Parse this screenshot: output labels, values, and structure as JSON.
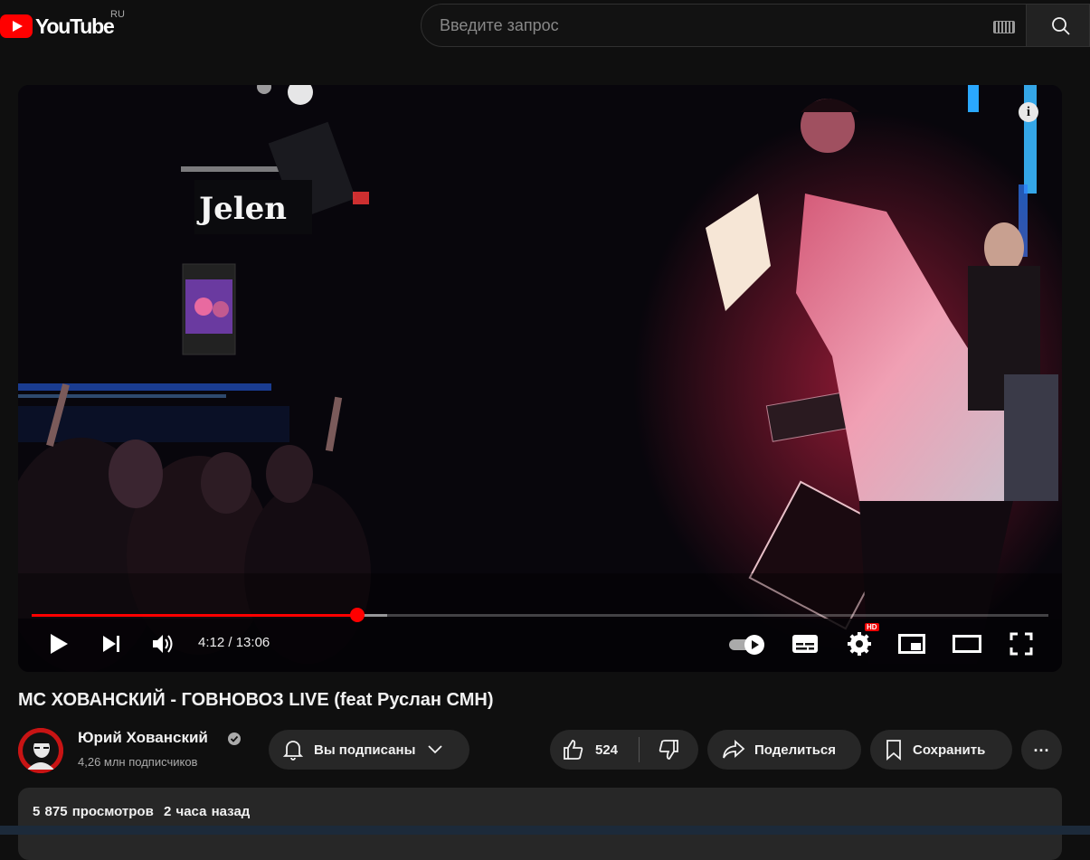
{
  "masthead": {
    "logo_text": "YouTube",
    "country_code": "RU",
    "search_placeholder": "Введите запрос",
    "keyboard_icon": "keyboard-icon",
    "search_icon": "search-icon"
  },
  "player": {
    "time_current": "4:12",
    "time_separator": " / ",
    "time_total": "13:06",
    "progress": {
      "played_fraction": 0.32,
      "buffered_fraction": 0.35
    },
    "venue_sign": "Jelen",
    "controls": {
      "play_icon": "play-icon",
      "next_icon": "next-icon",
      "volume_icon": "volume-icon",
      "autoplay_icon": "autoplay-toggle-icon",
      "subtitles_icon": "subtitles-icon",
      "settings_icon": "settings-icon",
      "settings_badge": "HD",
      "miniplayer_icon": "miniplayer-icon",
      "theater_icon": "theater-mode-icon",
      "fullscreen_icon": "fullscreen-icon"
    },
    "info_icon": "i"
  },
  "video": {
    "title": "MC ХОВАНСКИЙ - ГОВНОВОЗ LIVE (feat Руслан СМН)",
    "channel_name": "Юрий Хованский",
    "subscribers": "4,26 млн подписчиков",
    "subscribe_label": "Вы подписаны",
    "likes": "524",
    "share_label": "Поделиться",
    "save_label": "Сохранить",
    "more_label": "..."
  },
  "description": {
    "views": "5 875 просмотров",
    "date": "2 часа назад"
  },
  "colors": {
    "background": "#0f0f0f",
    "accent_red": "#ff0000",
    "pill": "#272727",
    "text_secondary": "#aaaaaa"
  }
}
